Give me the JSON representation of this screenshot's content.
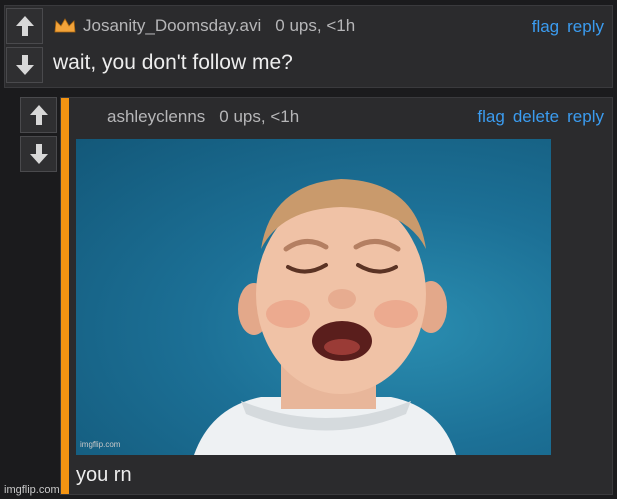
{
  "comment1": {
    "username": "Josanity_Doomsday.avi",
    "meta": "0 ups, <1h",
    "actions": [
      "flag",
      "reply"
    ],
    "text": "wait, you don't follow me?"
  },
  "comment2": {
    "username": "ashleyclenns",
    "meta": "0 ups, <1h",
    "actions": [
      "flag",
      "delete",
      "reply"
    ],
    "image_watermark": "imgflip.com",
    "caption": "you rn"
  },
  "footer_watermark": "imgflip.com",
  "colors": {
    "accent_link": "#3b9cf0",
    "reply_bar": "#f39412",
    "badge": "#f2a33a"
  }
}
